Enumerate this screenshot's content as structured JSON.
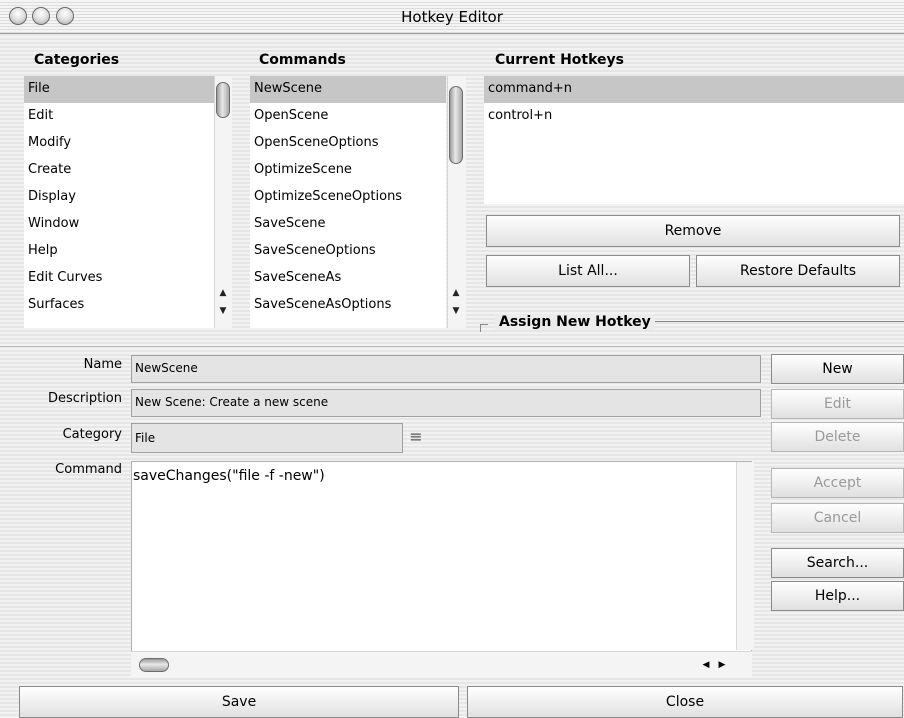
{
  "window": {
    "title": "Hotkey Editor"
  },
  "categories": {
    "header": "Categories",
    "items": [
      "File",
      "Edit",
      "Modify",
      "Create",
      "Display",
      "Window",
      "Help",
      "Edit Curves",
      "Surfaces"
    ],
    "selected_index": 0
  },
  "commands": {
    "header": "Commands",
    "items": [
      "NewScene",
      "OpenScene",
      "OpenSceneOptions",
      "OptimizeScene",
      "OptimizeSceneOptions",
      "SaveScene",
      "SaveSceneOptions",
      "SaveSceneAs",
      "SaveSceneAsOptions"
    ],
    "selected_index": 0
  },
  "current_hotkeys": {
    "header": "Current Hotkeys",
    "items": [
      "command+n",
      "control+n"
    ],
    "selected_index": 0
  },
  "buttons": {
    "remove": "Remove",
    "list_all": "List All...",
    "restore_defaults": "Restore Defaults",
    "new": "New",
    "edit": "Edit",
    "delete": "Delete",
    "accept": "Accept",
    "cancel": "Cancel",
    "search": "Search...",
    "help": "Help...",
    "save": "Save",
    "close": "Close"
  },
  "assign_group": {
    "title": "Assign New Hotkey"
  },
  "form": {
    "name_label": "Name",
    "name_value": "NewScene",
    "description_label": "Description",
    "description_value": "New Scene: Create a new scene",
    "category_label": "Category",
    "category_value": "File",
    "command_label": "Command",
    "command_value": "saveChanges(\"file -f -new\")"
  }
}
